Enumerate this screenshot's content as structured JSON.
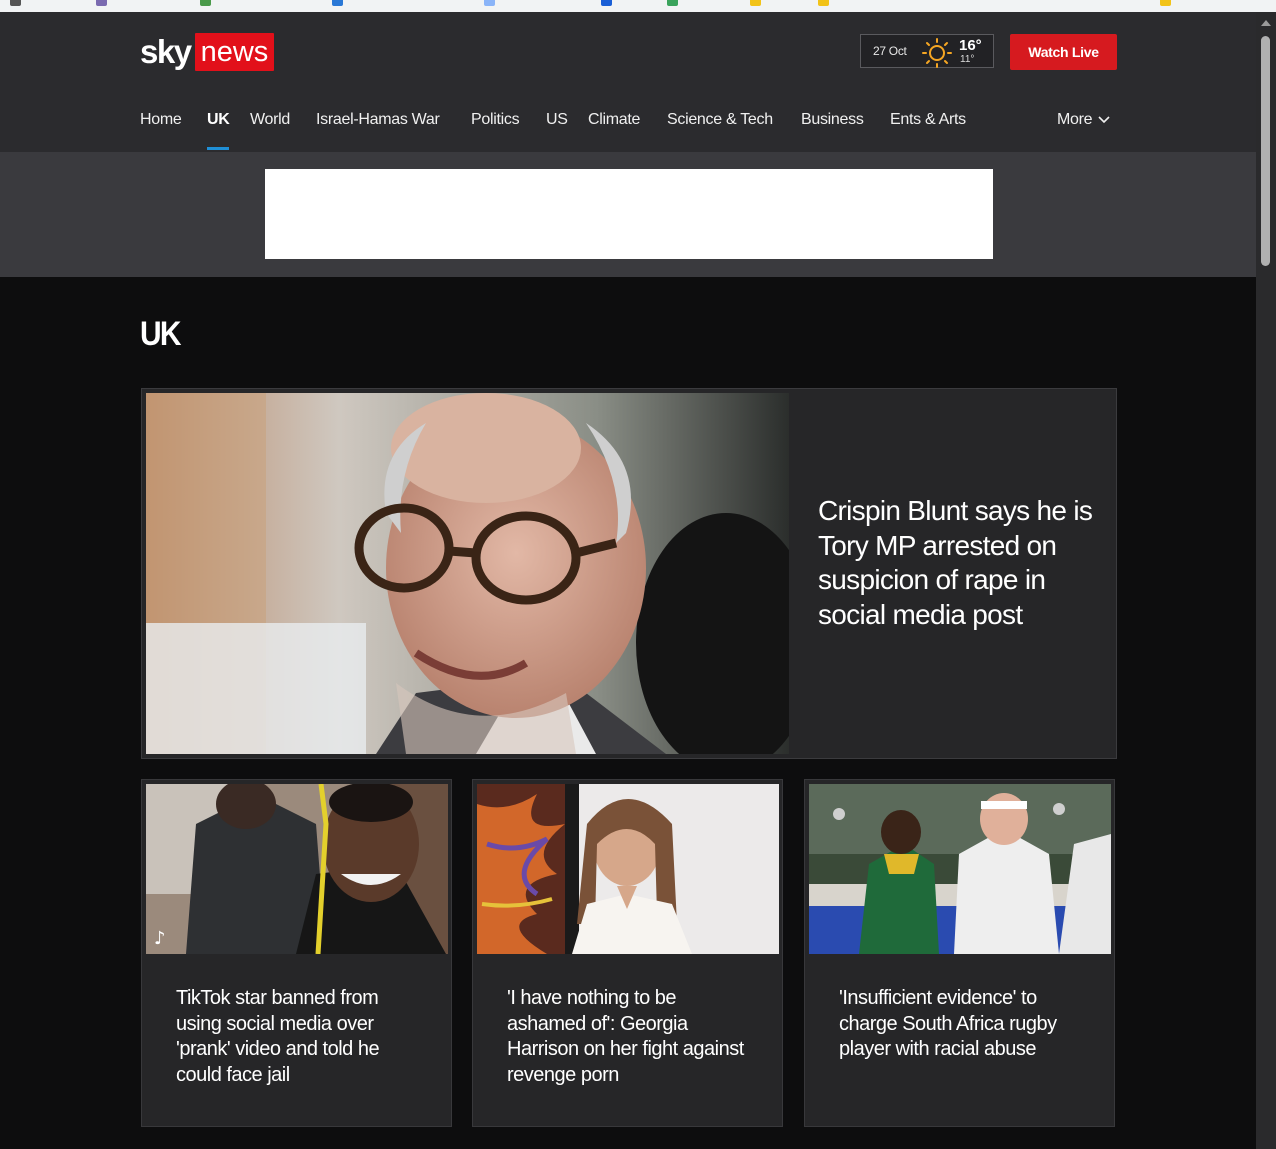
{
  "brand": {
    "sky": "sky",
    "news": "news"
  },
  "weather": {
    "date": "27 Oct",
    "high": "16°",
    "low": "11°",
    "icon": "sun-icon"
  },
  "watch_live": "Watch Live",
  "nav": {
    "items": [
      "Home",
      "UK",
      "World",
      "Israel-Hamas War",
      "Politics",
      "US",
      "Climate",
      "Science & Tech",
      "Business",
      "Ents & Arts"
    ],
    "active": "UK",
    "more": "More"
  },
  "section": {
    "title": "UK"
  },
  "hero": {
    "headline": "Crispin Blunt says he is Tory MP arrested on suspicion of rape in social media post",
    "image": "man-with-glasses-photo"
  },
  "cards": [
    {
      "headline": "TikTok star banned from using social media over 'prank' video and told he could face jail",
      "image": "tiktok-video-still"
    },
    {
      "headline": "'I have nothing to be ashamed of': Georgia Harrison on her fight against revenge porn",
      "image": "woman-portrait-photo"
    },
    {
      "headline": "'Insufficient evidence' to charge South Africa rugby player with racial abuse",
      "image": "rugby-match-photo"
    }
  ],
  "colors": {
    "brand_red": "#e2101a",
    "watch_red": "#d61a1f",
    "header_bg": "#2b2b2e",
    "active_underline": "#1f8fd6"
  }
}
